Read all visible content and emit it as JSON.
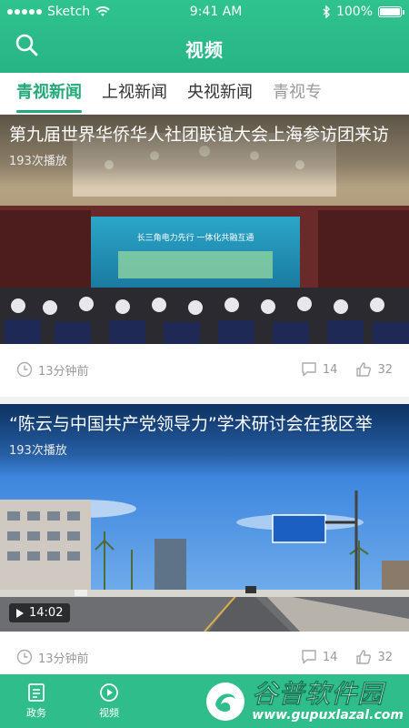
{
  "status_bar": {
    "carrier": "Sketch",
    "time": "9:41 AM",
    "battery": "100%"
  },
  "header": {
    "title": "视频"
  },
  "tabs": [
    {
      "label": "青视新闻",
      "active": true
    },
    {
      "label": "上视新闻"
    },
    {
      "label": "央视新闻"
    },
    {
      "label": "青视专"
    }
  ],
  "videos": [
    {
      "title": "第九届世界华侨华人社团联谊大会上海参访团来访",
      "plays": "193次播放",
      "posted": "13分钟前",
      "comments": "14",
      "likes": "32",
      "screen_text": "长三角电力先行 一体化共融互通"
    },
    {
      "title": "“陈云与中国共产党领导力”学术研讨会在我区举",
      "plays": "193次播放",
      "duration": "14:02",
      "posted": "13分钟前",
      "comments": "14",
      "likes": "32"
    }
  ],
  "bottom_nav": [
    {
      "label": "政务",
      "icon": "document-icon"
    },
    {
      "label": "视频",
      "icon": "play-circle-icon"
    }
  ],
  "watermark": {
    "name": "谷普软件园",
    "url": "www.gupuxlazal.com"
  },
  "colors": {
    "primary": "#2fbd8c",
    "active_tab": "#23a97a",
    "muted": "#999999"
  }
}
